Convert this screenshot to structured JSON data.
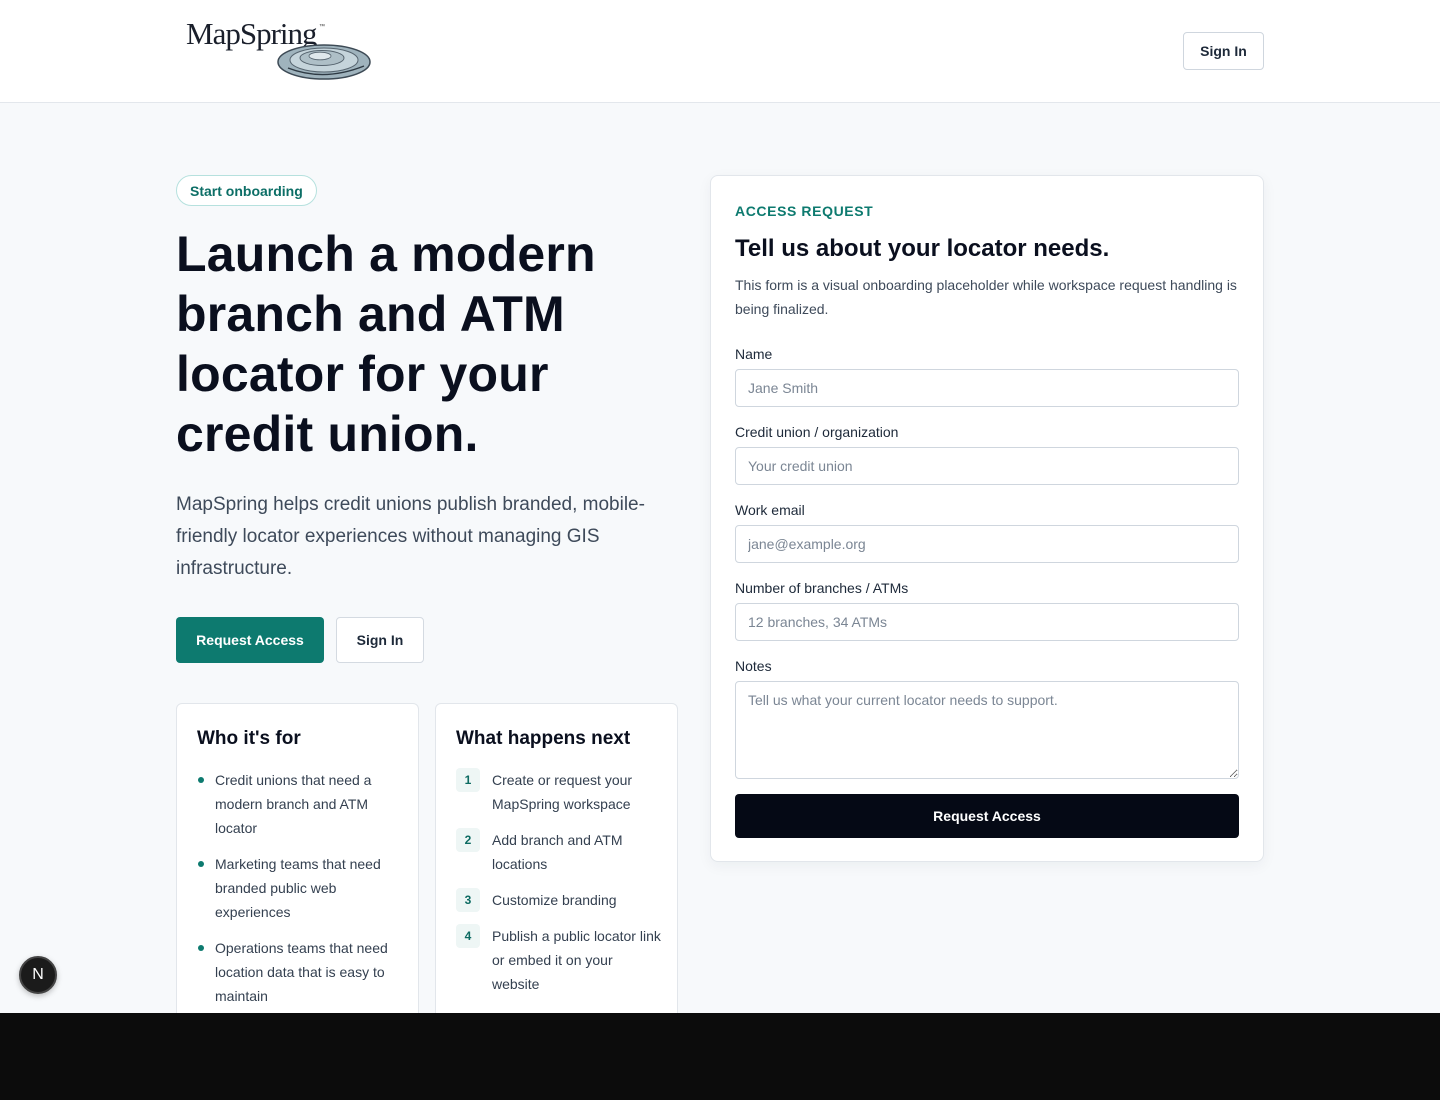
{
  "header": {
    "logo_text": "MapSpring",
    "logo_tm": "™",
    "sign_in_label": "Sign In"
  },
  "hero": {
    "badge": "Start onboarding",
    "title": "Launch a modern branch and ATM locator for your credit union.",
    "description": "MapSpring helps credit unions publish branded, mobile-friendly locator experiences without managing GIS infrastructure.",
    "primary_button": "Request Access",
    "secondary_button": "Sign In"
  },
  "who_card": {
    "title": "Who it's for",
    "items": [
      "Credit unions that need a modern branch and ATM locator",
      "Marketing teams that need branded public web experiences",
      "Operations teams that need location data that is easy to maintain"
    ]
  },
  "next_card": {
    "title": "What happens next",
    "steps": [
      {
        "num": "1",
        "text": "Create or request your MapSpring workspace"
      },
      {
        "num": "2",
        "text": "Add branch and ATM locations"
      },
      {
        "num": "3",
        "text": "Customize branding"
      },
      {
        "num": "4",
        "text": "Publish a public locator link or embed it on your website"
      }
    ]
  },
  "form": {
    "eyebrow": "ACCESS REQUEST",
    "title": "Tell us about your locator needs.",
    "description": "This form is a visual onboarding placeholder while workspace request handling is being finalized.",
    "fields": {
      "name": {
        "label": "Name",
        "placeholder": "Jane Smith",
        "value": ""
      },
      "organization": {
        "label": "Credit union / organization",
        "placeholder": "Your credit union",
        "value": ""
      },
      "email": {
        "label": "Work email",
        "placeholder": "jane@example.org",
        "value": ""
      },
      "branches": {
        "label": "Number of branches / ATMs",
        "placeholder": "12 branches, 34 ATMs",
        "value": ""
      },
      "notes": {
        "label": "Notes",
        "placeholder": "Tell us what your current locator needs to support.",
        "value": ""
      }
    },
    "submit_label": "Request Access"
  },
  "dev_badge": {
    "label": "N"
  },
  "colors": {
    "accent": "#0d7a6f",
    "dark_button": "#050915",
    "background": "#f7f9fb"
  }
}
